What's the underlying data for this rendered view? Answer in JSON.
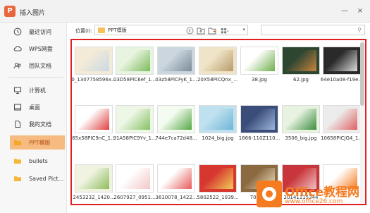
{
  "window": {
    "logo_glyph": "P",
    "title": "插入图片",
    "minimize_glyph": "—",
    "close_glyph": "×"
  },
  "sidebar": {
    "items": [
      {
        "label": "最近访问",
        "icon": "clock-icon"
      },
      {
        "label": "WPS网盘",
        "icon": "cloud-icon"
      },
      {
        "label": "团队文档",
        "icon": "team-icon"
      },
      {
        "label": "计算机",
        "icon": "computer-icon"
      },
      {
        "label": "桌面",
        "icon": "desktop-icon"
      },
      {
        "label": "我的文档",
        "icon": "document-icon"
      },
      {
        "label": "PPT模版",
        "icon": "folder-icon"
      },
      {
        "label": "bullets",
        "icon": "folder-icon"
      },
      {
        "label": "Saved Pict...",
        "icon": "folder-icon"
      }
    ],
    "active_index": 6
  },
  "toolbar": {
    "location_label": "位置(I):",
    "location_value": "PPT模版",
    "search_placeholder": ""
  },
  "thumbnails": {
    "rows": [
      [
        {
          "caption": "0_1307758596x...",
          "colors": [
            "#f3ead7",
            "#c9d8e6"
          ]
        },
        {
          "caption": "03D58PIC6ef_1...",
          "colors": [
            "#e7f4df",
            "#7dba5b"
          ]
        },
        {
          "caption": "03z58PICFyK_1...",
          "colors": [
            "#ccd6de",
            "#7a8c99"
          ]
        },
        {
          "caption": "20X58PICQnx_...",
          "colors": [
            "#efe4c7",
            "#b89b6a"
          ]
        },
        {
          "caption": "38.jpg",
          "colors": [
            "#ffffff",
            "#6fae4a"
          ]
        },
        {
          "caption": "62.jpg",
          "colors": [
            "#2c4632",
            "#c9833d"
          ]
        },
        {
          "caption": "64e10a08-f19e...",
          "colors": [
            "#2a2a2a",
            "#dcdcdc"
          ]
        }
      ],
      [
        {
          "caption": "65x58PIC9nC_1...",
          "colors": [
            "#ffffff",
            "#e04040"
          ]
        },
        {
          "caption": "91A58PIC9Yv_1...",
          "colors": [
            "#eef6e6",
            "#86c163"
          ]
        },
        {
          "caption": "744e7ca72d48...",
          "colors": [
            "#f4fbf0",
            "#53a844"
          ]
        },
        {
          "caption": "1024_big.jpg",
          "colors": [
            "#bfe0ee",
            "#6fb5d8"
          ]
        },
        {
          "caption": "1666-110Z110...",
          "colors": [
            "#3b4e7a",
            "#9cb6da"
          ]
        },
        {
          "caption": "3506_big.jpg",
          "colors": [
            "#e8f2e0",
            "#3b8d3f"
          ]
        },
        {
          "caption": "10658PICJG4_1...",
          "colors": [
            "#ececec",
            "#e06060"
          ]
        }
      ],
      [
        {
          "caption": "2453232_1420...",
          "colors": [
            "#f0f3e2",
            "#8dbd5b"
          ]
        },
        {
          "caption": "2607927_0951...",
          "colors": [
            "#ffffff",
            "#f3c7c7"
          ]
        },
        {
          "caption": "3610078_1422...",
          "colors": [
            "#ffffff",
            "#e85a5a"
          ]
        },
        {
          "caption": "5802522_1039...",
          "colors": [
            "#d6372f",
            "#f3cc58"
          ]
        },
        {
          "caption": "700937",
          "colors": [
            "#8b6a42",
            "#efe1c0"
          ]
        },
        {
          "caption": "20141115344",
          "colors": [
            "#c8363b",
            "#f0c0c0"
          ]
        },
        {
          "caption": "",
          "colors": [
            "#ffffff",
            "#f57b20"
          ]
        }
      ]
    ]
  },
  "watermark": {
    "brand": "Office教程网",
    "url": "www.office26.com"
  },
  "colors": {
    "accent": "#f57b20",
    "active_bg": "#f6bb80",
    "highlight_border": "#e02020"
  }
}
